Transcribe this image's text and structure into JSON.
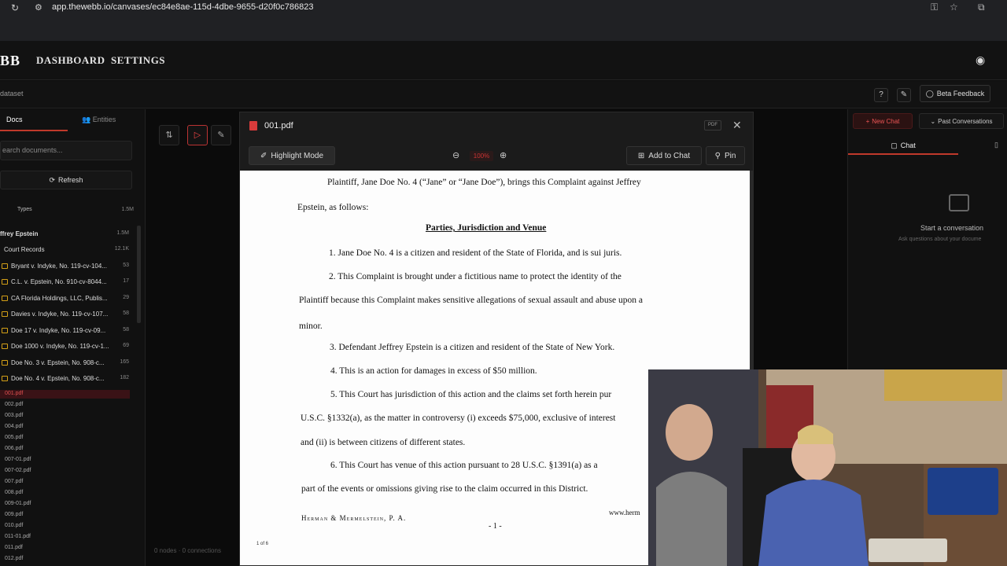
{
  "browser": {
    "url": "app.thewebb.io/canvases/ec84e8ae-115d-4dbe-9655-d20f0c786823"
  },
  "header": {
    "logo": "BB",
    "nav": [
      "DASHBOARD",
      "SETTINGS"
    ]
  },
  "subbar": {
    "crumb": "dataset",
    "beta_label": "Beta Feedback"
  },
  "sidebar": {
    "tabs": [
      "Docs",
      "Entities"
    ],
    "search_placeholder": "earch documents...",
    "refresh_label": "Refresh",
    "types_label": "Types",
    "types_count": "1.5M",
    "tree": [
      {
        "label": "ffrey Epstein",
        "count": "1.5M",
        "bold": true
      },
      {
        "label": "Court Records",
        "count": "12.1K",
        "bold": false
      },
      {
        "label": "Bryant v. Indyke, No. 119-cv-104...",
        "count": "53"
      },
      {
        "label": "C.L. v. Epstein, No. 910-cv-8044...",
        "count": "17"
      },
      {
        "label": "CA Florida Holdings, LLC, Publis...",
        "count": "29"
      },
      {
        "label": "Davies v. Indyke, No. 119-cv-107...",
        "count": "58"
      },
      {
        "label": "Doe 17 v. Indyke, No. 119-cv-09...",
        "count": "58"
      },
      {
        "label": "Doe 1000 v. Indyke, No. 119-cv-1...",
        "count": "69"
      },
      {
        "label": "Doe No. 3 v. Epstein, No. 908-c...",
        "count": "165"
      },
      {
        "label": "Doe No. 4 v. Epstein, No. 908-c...",
        "count": "182"
      }
    ],
    "files": [
      "001.pdf",
      "002.pdf",
      "003.pdf",
      "004.pdf",
      "005.pdf",
      "006.pdf",
      "007-01.pdf",
      "007-02.pdf",
      "007.pdf",
      "008.pdf",
      "009-01.pdf",
      "009.pdf",
      "010.pdf",
      "011-01.pdf",
      "011.pdf",
      "012.pdf"
    ]
  },
  "canvas": {
    "status": "0 nodes · 0 connections"
  },
  "pdf": {
    "filename": "001.pdf",
    "badge": "PDF",
    "highlight_label": "Highlight Mode",
    "zoom": "100%",
    "add_chat_label": "Add to Chat",
    "pin_label": "Pin",
    "lines": [
      "Plaintiff, Jane Doe No. 4 (“Jane” or “Jane Doe”), brings this Complaint against Jeffrey",
      "Epstein, as follows:",
      "Parties, Jurisdiction and Venue",
      "1.        Jane Doe No. 4 is a citizen and resident of the State of Florida, and is sui juris.",
      "2.        This Complaint is brought under a fictitious name to protect the identity of the",
      "Plaintiff because this Complaint makes sensitive allegations of sexual assault and abuse upon a",
      "minor.",
      "3.        Defendant Jeffrey Epstein is a citizen and resident of the State of New York.",
      "4.        This is an action for damages in excess of $50 million.",
      "5.        This Court has jurisdiction of this action and the claims set forth herein pur",
      "U.S.C. §1332(a), as the matter in controversy (i) exceeds $75,000, exclusive of  interest",
      "and (ii) is between citizens of different states.",
      "6.        This Court has venue of this action pursuant to 28 U.S.C. §1391(a) as a",
      "part of the events or omissions giving rise to the claim occurred in this District."
    ],
    "footer_firm": "Herman & Mermelstein, P. A.",
    "footer_page": "- 1 -",
    "footer_web": "www.herm",
    "page_of": "1 of 6"
  },
  "chat": {
    "new_chat_label": "New Chat",
    "past_label": "Past Conversations",
    "tab_label": "Chat",
    "empty_title": "Start a conversation",
    "empty_sub": "Ask questions about your docume"
  },
  "colors": {
    "accent": "#c0392b",
    "folder": "#d4a017"
  }
}
